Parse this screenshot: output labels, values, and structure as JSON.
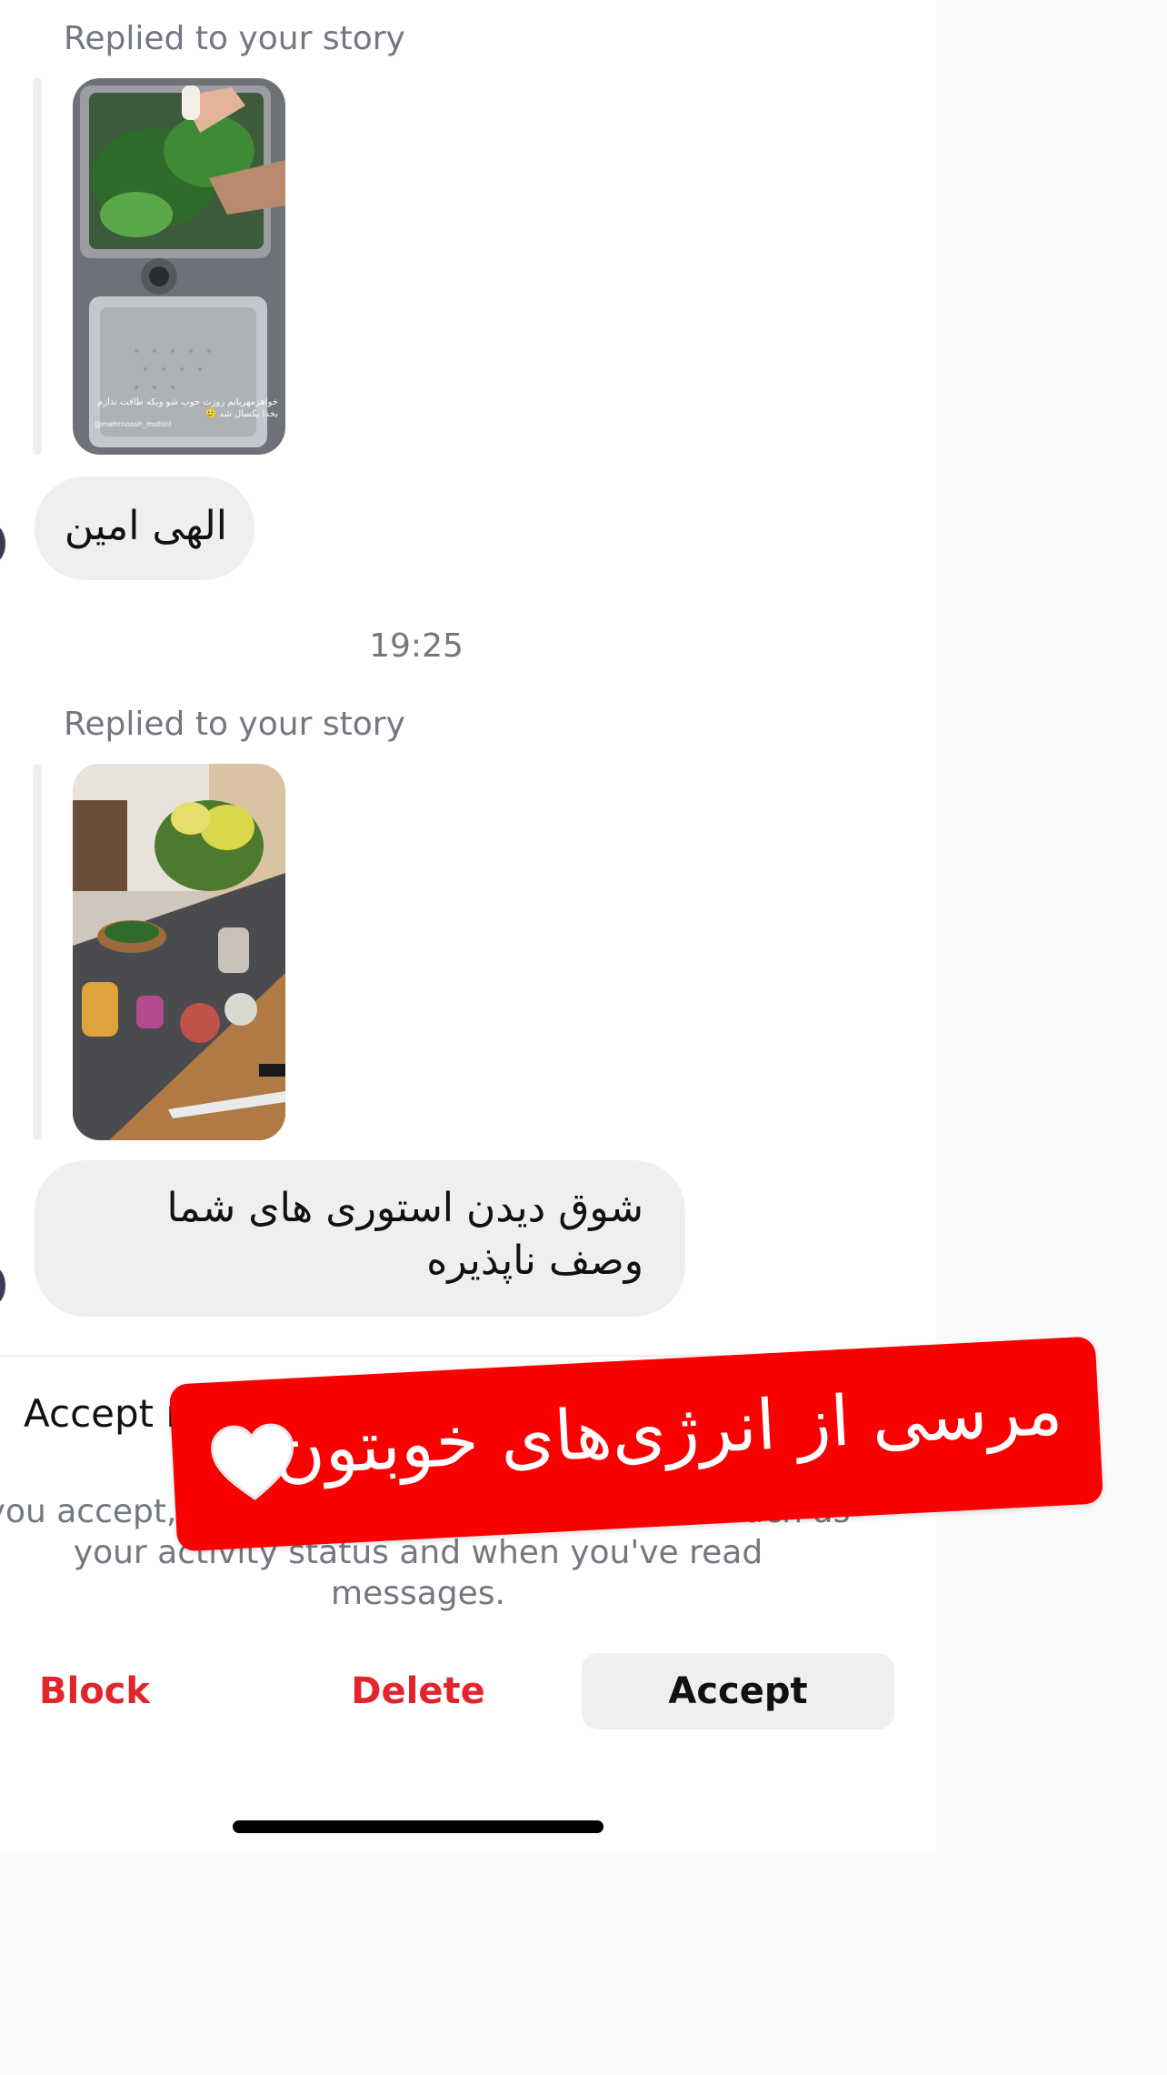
{
  "messages": [
    {
      "replied_label": "Replied to your story",
      "story_caption": "خواهرمهربانم روزت خوب شو ویکه طاقت ندارم بخدا یکسال شد 🥲",
      "story_handle": "@mehrnoosh_mohini",
      "text": "الهی امین"
    },
    {
      "replied_label": "Replied to your story",
      "text": "شوق دیدن استوری های شما وصف ناپذیره"
    }
  ],
  "timestamp": "19:25",
  "request_panel": {
    "title": "Accept mes",
    "description": "you accept, they will also be able to see info such as your activity status and when you've read messages."
  },
  "actions": {
    "block": "Block",
    "delete": "Delete",
    "accept": "Accept"
  },
  "sticker": {
    "text": "مرسی از انرژی‌های خوبتون",
    "icon": "white-heart-icon"
  },
  "colors": {
    "destructive": "#e0262b",
    "sticker_red": "#fb0000",
    "bubble_bg": "#efeff2",
    "secondary_text": "#737780"
  }
}
